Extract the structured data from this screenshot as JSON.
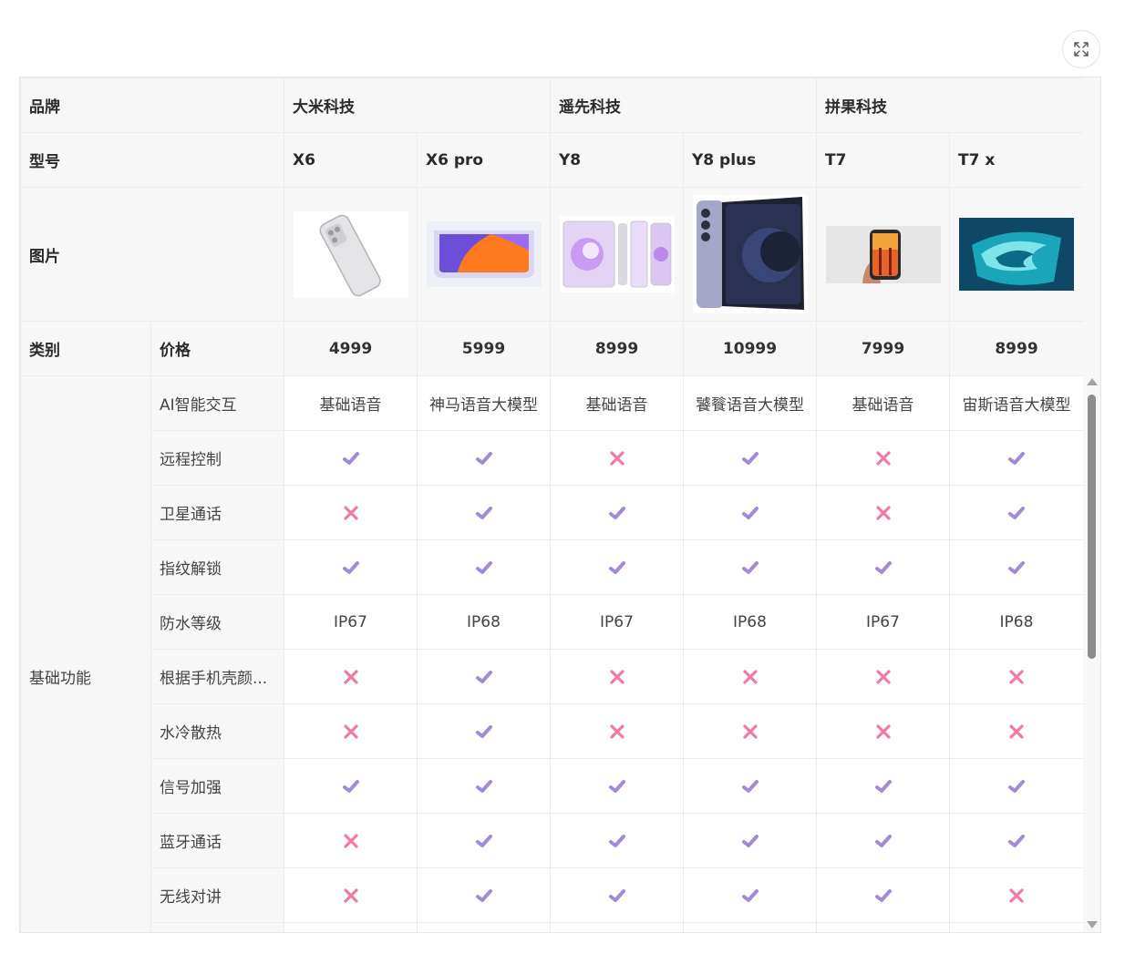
{
  "row_labels": {
    "brand": "品牌",
    "model": "型号",
    "image": "图片",
    "category": "类别",
    "price": "价格",
    "basic_features": "基础功能"
  },
  "brands": [
    "大米科技",
    "遥先科技",
    "拼果科技"
  ],
  "models": [
    "X6",
    "X6 pro",
    "Y8",
    "Y8 plus",
    "T7",
    "T7 x"
  ],
  "prices": [
    "4999",
    "5999",
    "8999",
    "10999",
    "7999",
    "8999"
  ],
  "features": [
    {
      "name": "AI智能交互",
      "values": [
        "基础语音",
        "神马语音大模型",
        "基础语音",
        "饕餮语音大模型",
        "基础语音",
        "宙斯语音大模型"
      ]
    },
    {
      "name": "远程控制",
      "values": [
        true,
        true,
        false,
        true,
        false,
        true
      ]
    },
    {
      "name": "卫星通话",
      "values": [
        false,
        true,
        true,
        true,
        false,
        true
      ]
    },
    {
      "name": "指纹解锁",
      "values": [
        true,
        true,
        true,
        true,
        true,
        true
      ]
    },
    {
      "name": "防水等级",
      "values": [
        "IP67",
        "IP68",
        "IP67",
        "IP68",
        "IP67",
        "IP68"
      ]
    },
    {
      "name": "根据手机壳颜...",
      "values": [
        false,
        true,
        false,
        false,
        false,
        false
      ]
    },
    {
      "name": "水冷散热",
      "values": [
        false,
        true,
        false,
        false,
        false,
        false
      ]
    },
    {
      "name": "信号加强",
      "values": [
        true,
        true,
        true,
        true,
        true,
        true
      ]
    },
    {
      "name": "蓝牙通话",
      "values": [
        false,
        true,
        true,
        true,
        true,
        true
      ]
    },
    {
      "name": "无线对讲",
      "values": [
        false,
        true,
        true,
        true,
        true,
        false
      ]
    }
  ],
  "icons": {
    "expand": "expand-icon",
    "yes": "check-icon",
    "no": "cross-icon",
    "scroll_up": "scroll-up-arrow-icon",
    "scroll_down": "scroll-down-arrow-icon"
  },
  "colors": {
    "check": "#a28bd4",
    "cross": "#f07aa5",
    "header_bg": "#f7f7f7",
    "border": "#ececec"
  }
}
